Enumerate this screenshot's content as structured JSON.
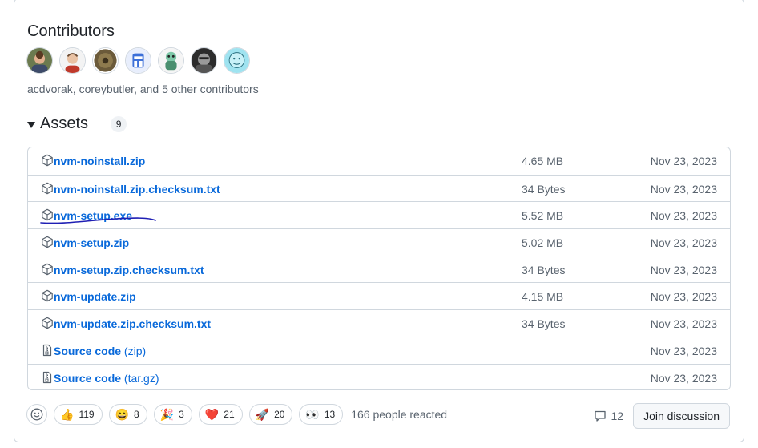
{
  "contributors": {
    "title": "Contributors",
    "summary": "acdvorak, coreybutler, and 5 other contributors",
    "avatar_count": 7
  },
  "assets": {
    "title": "Assets",
    "count": "9",
    "rows": [
      {
        "name": "nvm-noinstall.zip",
        "suffix": "",
        "size": "4.65 MB",
        "date": "Nov 23, 2023",
        "icon": "package-icon"
      },
      {
        "name": "nvm-noinstall.zip.checksum.txt",
        "suffix": "",
        "size": "34 Bytes",
        "date": "Nov 23, 2023",
        "icon": "package-icon"
      },
      {
        "name": "nvm-setup.exe",
        "suffix": "",
        "size": "5.52 MB",
        "date": "Nov 23, 2023",
        "icon": "package-icon"
      },
      {
        "name": "nvm-setup.zip",
        "suffix": "",
        "size": "5.02 MB",
        "date": "Nov 23, 2023",
        "icon": "package-icon"
      },
      {
        "name": "nvm-setup.zip.checksum.txt",
        "suffix": "",
        "size": "34 Bytes",
        "date": "Nov 23, 2023",
        "icon": "package-icon"
      },
      {
        "name": "nvm-update.zip",
        "suffix": "",
        "size": "4.15 MB",
        "date": "Nov 23, 2023",
        "icon": "package-icon"
      },
      {
        "name": "nvm-update.zip.checksum.txt",
        "suffix": "",
        "size": "34 Bytes",
        "date": "Nov 23, 2023",
        "icon": "package-icon"
      },
      {
        "name": "Source code",
        "suffix": "(zip)",
        "size": "",
        "date": "Nov 23, 2023",
        "icon": "file-zip-icon"
      },
      {
        "name": "Source code",
        "suffix": "(tar.gz)",
        "size": "",
        "date": "Nov 23, 2023",
        "icon": "file-zip-icon"
      }
    ]
  },
  "reactions": {
    "items": [
      {
        "emoji": "👍",
        "count": "119",
        "name": "thumbs-up"
      },
      {
        "emoji": "😄",
        "count": "8",
        "name": "laugh"
      },
      {
        "emoji": "🎉",
        "count": "3",
        "name": "hooray"
      },
      {
        "emoji": "❤️",
        "count": "21",
        "name": "heart"
      },
      {
        "emoji": "🚀",
        "count": "20",
        "name": "rocket"
      },
      {
        "emoji": "👀",
        "count": "13",
        "name": "eyes"
      }
    ],
    "summary": "166 people reacted"
  },
  "discussion": {
    "comment_count": "12",
    "join_label": "Join discussion"
  },
  "colors": {
    "link": "#0969da",
    "muted": "#59636e",
    "border": "#d0d7de",
    "annotation": "#1f1fb4"
  }
}
